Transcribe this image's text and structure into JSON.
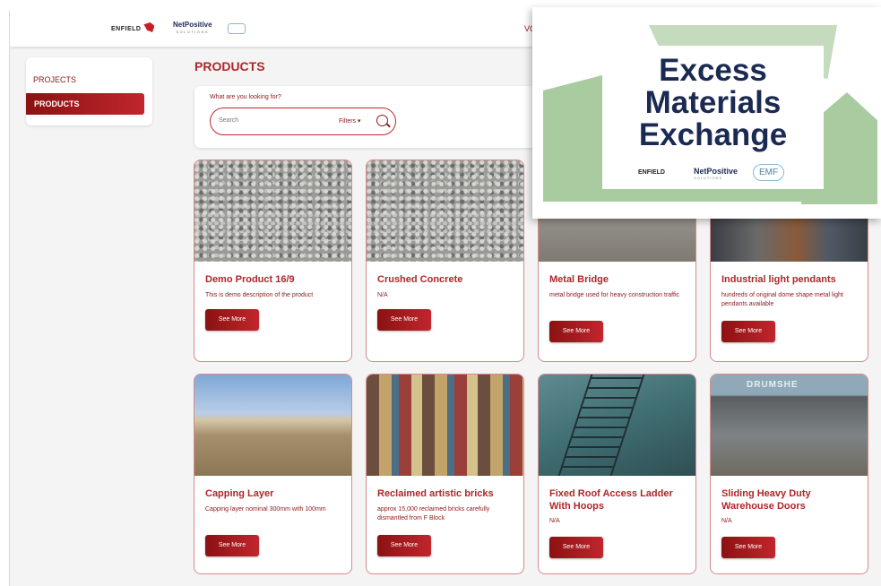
{
  "header": {
    "enfield_logo": "ENFIELD",
    "netpositive_logo": "NetPositive",
    "netpositive_sub": "SOLUTIONS",
    "nav_partial": "VO"
  },
  "sidebar": {
    "items": [
      {
        "label": "PROJECTS",
        "active": false
      },
      {
        "label": "PRODUCTS",
        "active": true
      }
    ]
  },
  "main": {
    "title": "PRODUCTS",
    "search": {
      "question": "What are you looking for?",
      "placeholder": "Search",
      "filters_label": "Filters ▾"
    }
  },
  "products": [
    {
      "title": "Demo Product 16/9",
      "description": "This is demo description of the product",
      "button": "See More"
    },
    {
      "title": "Crushed Concrete",
      "description": "N/A",
      "button": "See More"
    },
    {
      "title": "Metal Bridge",
      "description": "metal bridge used for heavy construction traffic",
      "button": "See More"
    },
    {
      "title": "Industrial light pendants",
      "description": "hundreds of original dome shape metal light pendants available",
      "button": "See More"
    },
    {
      "title": "Capping Layer",
      "description": "Capping layer nominal 300mm with 100mm",
      "button": "See More"
    },
    {
      "title": "Reclaimed artistic bricks",
      "description": "approx 15,000 reclaimed bricks carefully dismantled from F Block",
      "button": "See More"
    },
    {
      "title": "Fixed Roof Access Ladder With Hoops",
      "description": "N/A",
      "button": "See More"
    },
    {
      "title": "Sliding Heavy Duty Warehouse Doors",
      "description": "N/A",
      "button": "See More"
    }
  ],
  "image_texts": {
    "drumshed_sign": "DRUMSHE"
  },
  "overlay": {
    "title_line1": "Excess",
    "title_line2": "Materials",
    "title_line3": "Exchange",
    "enfield_logo": "ENFIELD",
    "netpositive_logo": "NetPositive",
    "netpositive_sub": "SOLUTIONS",
    "emf_logo": "EMF"
  },
  "colors": {
    "brand_red": "#b0262a",
    "dark_red": "#8b1212",
    "navy": "#1b2a52",
    "sage": "#a9cba0"
  }
}
